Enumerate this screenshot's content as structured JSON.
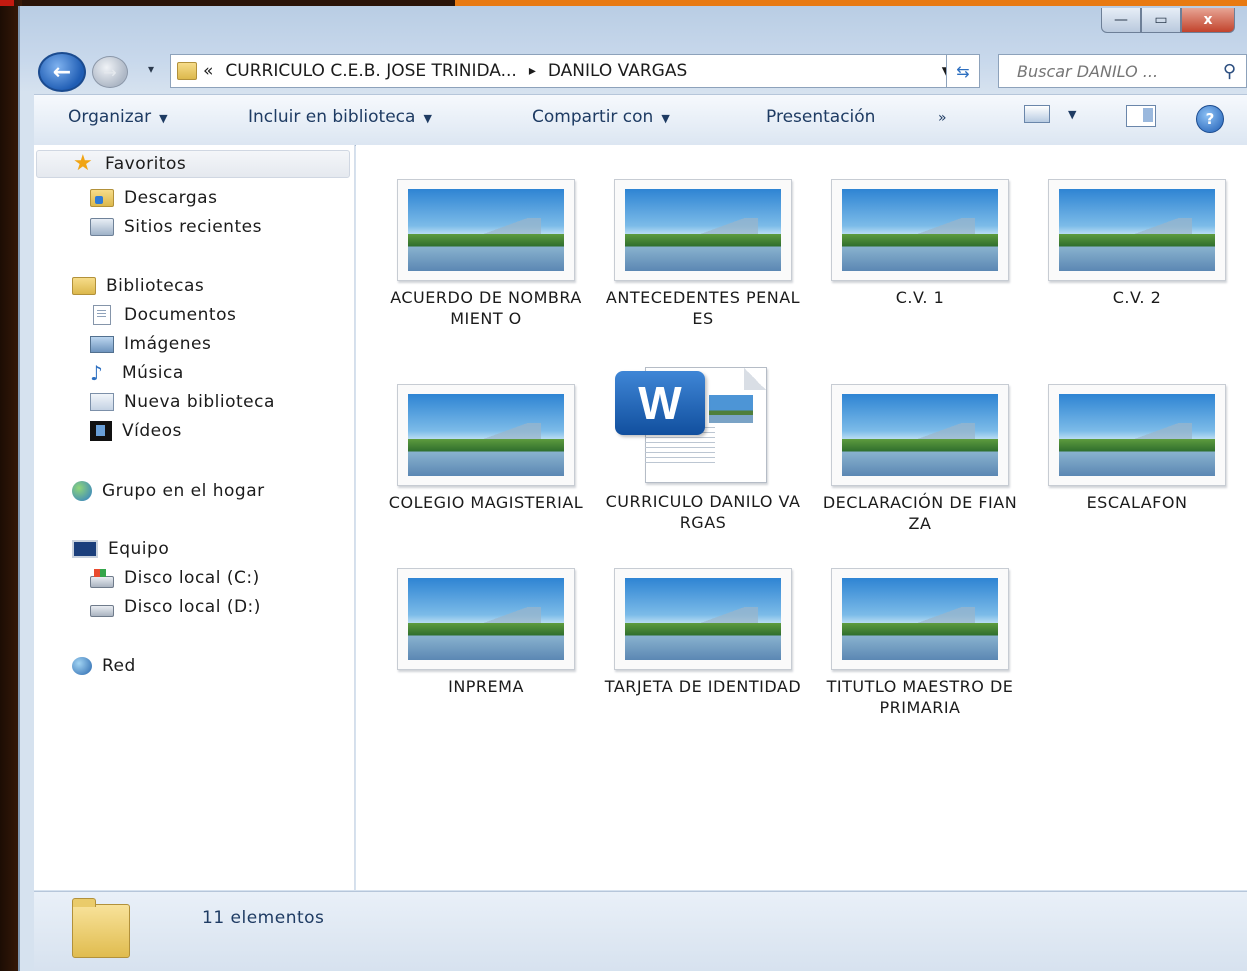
{
  "address": {
    "back_arrow": "←",
    "crumbs": [
      "«",
      "CURRICULO  C.E.B. JOSE TRINIDA...",
      "▸",
      "DANILO VARGAS"
    ],
    "search_placeholder": "Buscar DANILO ..."
  },
  "window_buttons": {
    "minimize": "—",
    "maximize": "▭",
    "close": "x"
  },
  "toolbar": {
    "organize": "Organizar",
    "include": "Incluir en biblioteca",
    "share": "Compartir con",
    "slideshow": "Presentación",
    "more": "»"
  },
  "nav": {
    "favorites": "Favoritos",
    "downloads": "Descargas",
    "recent": "Sitios recientes",
    "libraries": "Bibliotecas",
    "documents": "Documentos",
    "pictures": "Imágenes",
    "music": "Música",
    "new_library": "Nueva biblioteca",
    "videos": "Vídeos",
    "homegroup": "Grupo en el hogar",
    "computer": "Equipo",
    "disk_c": "Disco local (C:)",
    "disk_d": "Disco local (D:)",
    "network": "Red"
  },
  "files": [
    {
      "label": "ACUERDO DE NOMBRAMIENT O",
      "icon": "image-thumbnail"
    },
    {
      "label": "ANTECEDENTES PENALES",
      "icon": "image-thumbnail"
    },
    {
      "label": "C.V. 1",
      "icon": "image-thumbnail"
    },
    {
      "label": "C.V. 2",
      "icon": "image-thumbnail"
    },
    {
      "label": "COLEGIO MAGISTERIAL",
      "icon": "image-thumbnail"
    },
    {
      "label": "CURRICULO DANILO VARGAS",
      "icon": "word-document",
      "badge": "W"
    },
    {
      "label": "DECLARACIÓN DE FIANZA",
      "icon": "image-thumbnail"
    },
    {
      "label": "ESCALAFON",
      "icon": "image-thumbnail"
    },
    {
      "label": "INPREMA",
      "icon": "image-thumbnail"
    },
    {
      "label": "TARJETA DE IDENTIDAD",
      "icon": "image-thumbnail"
    },
    {
      "label": "TITUTLO MAESTRO DE PRIMARIA",
      "icon": "image-thumbnail"
    }
  ],
  "status": {
    "count": "11 elementos"
  }
}
